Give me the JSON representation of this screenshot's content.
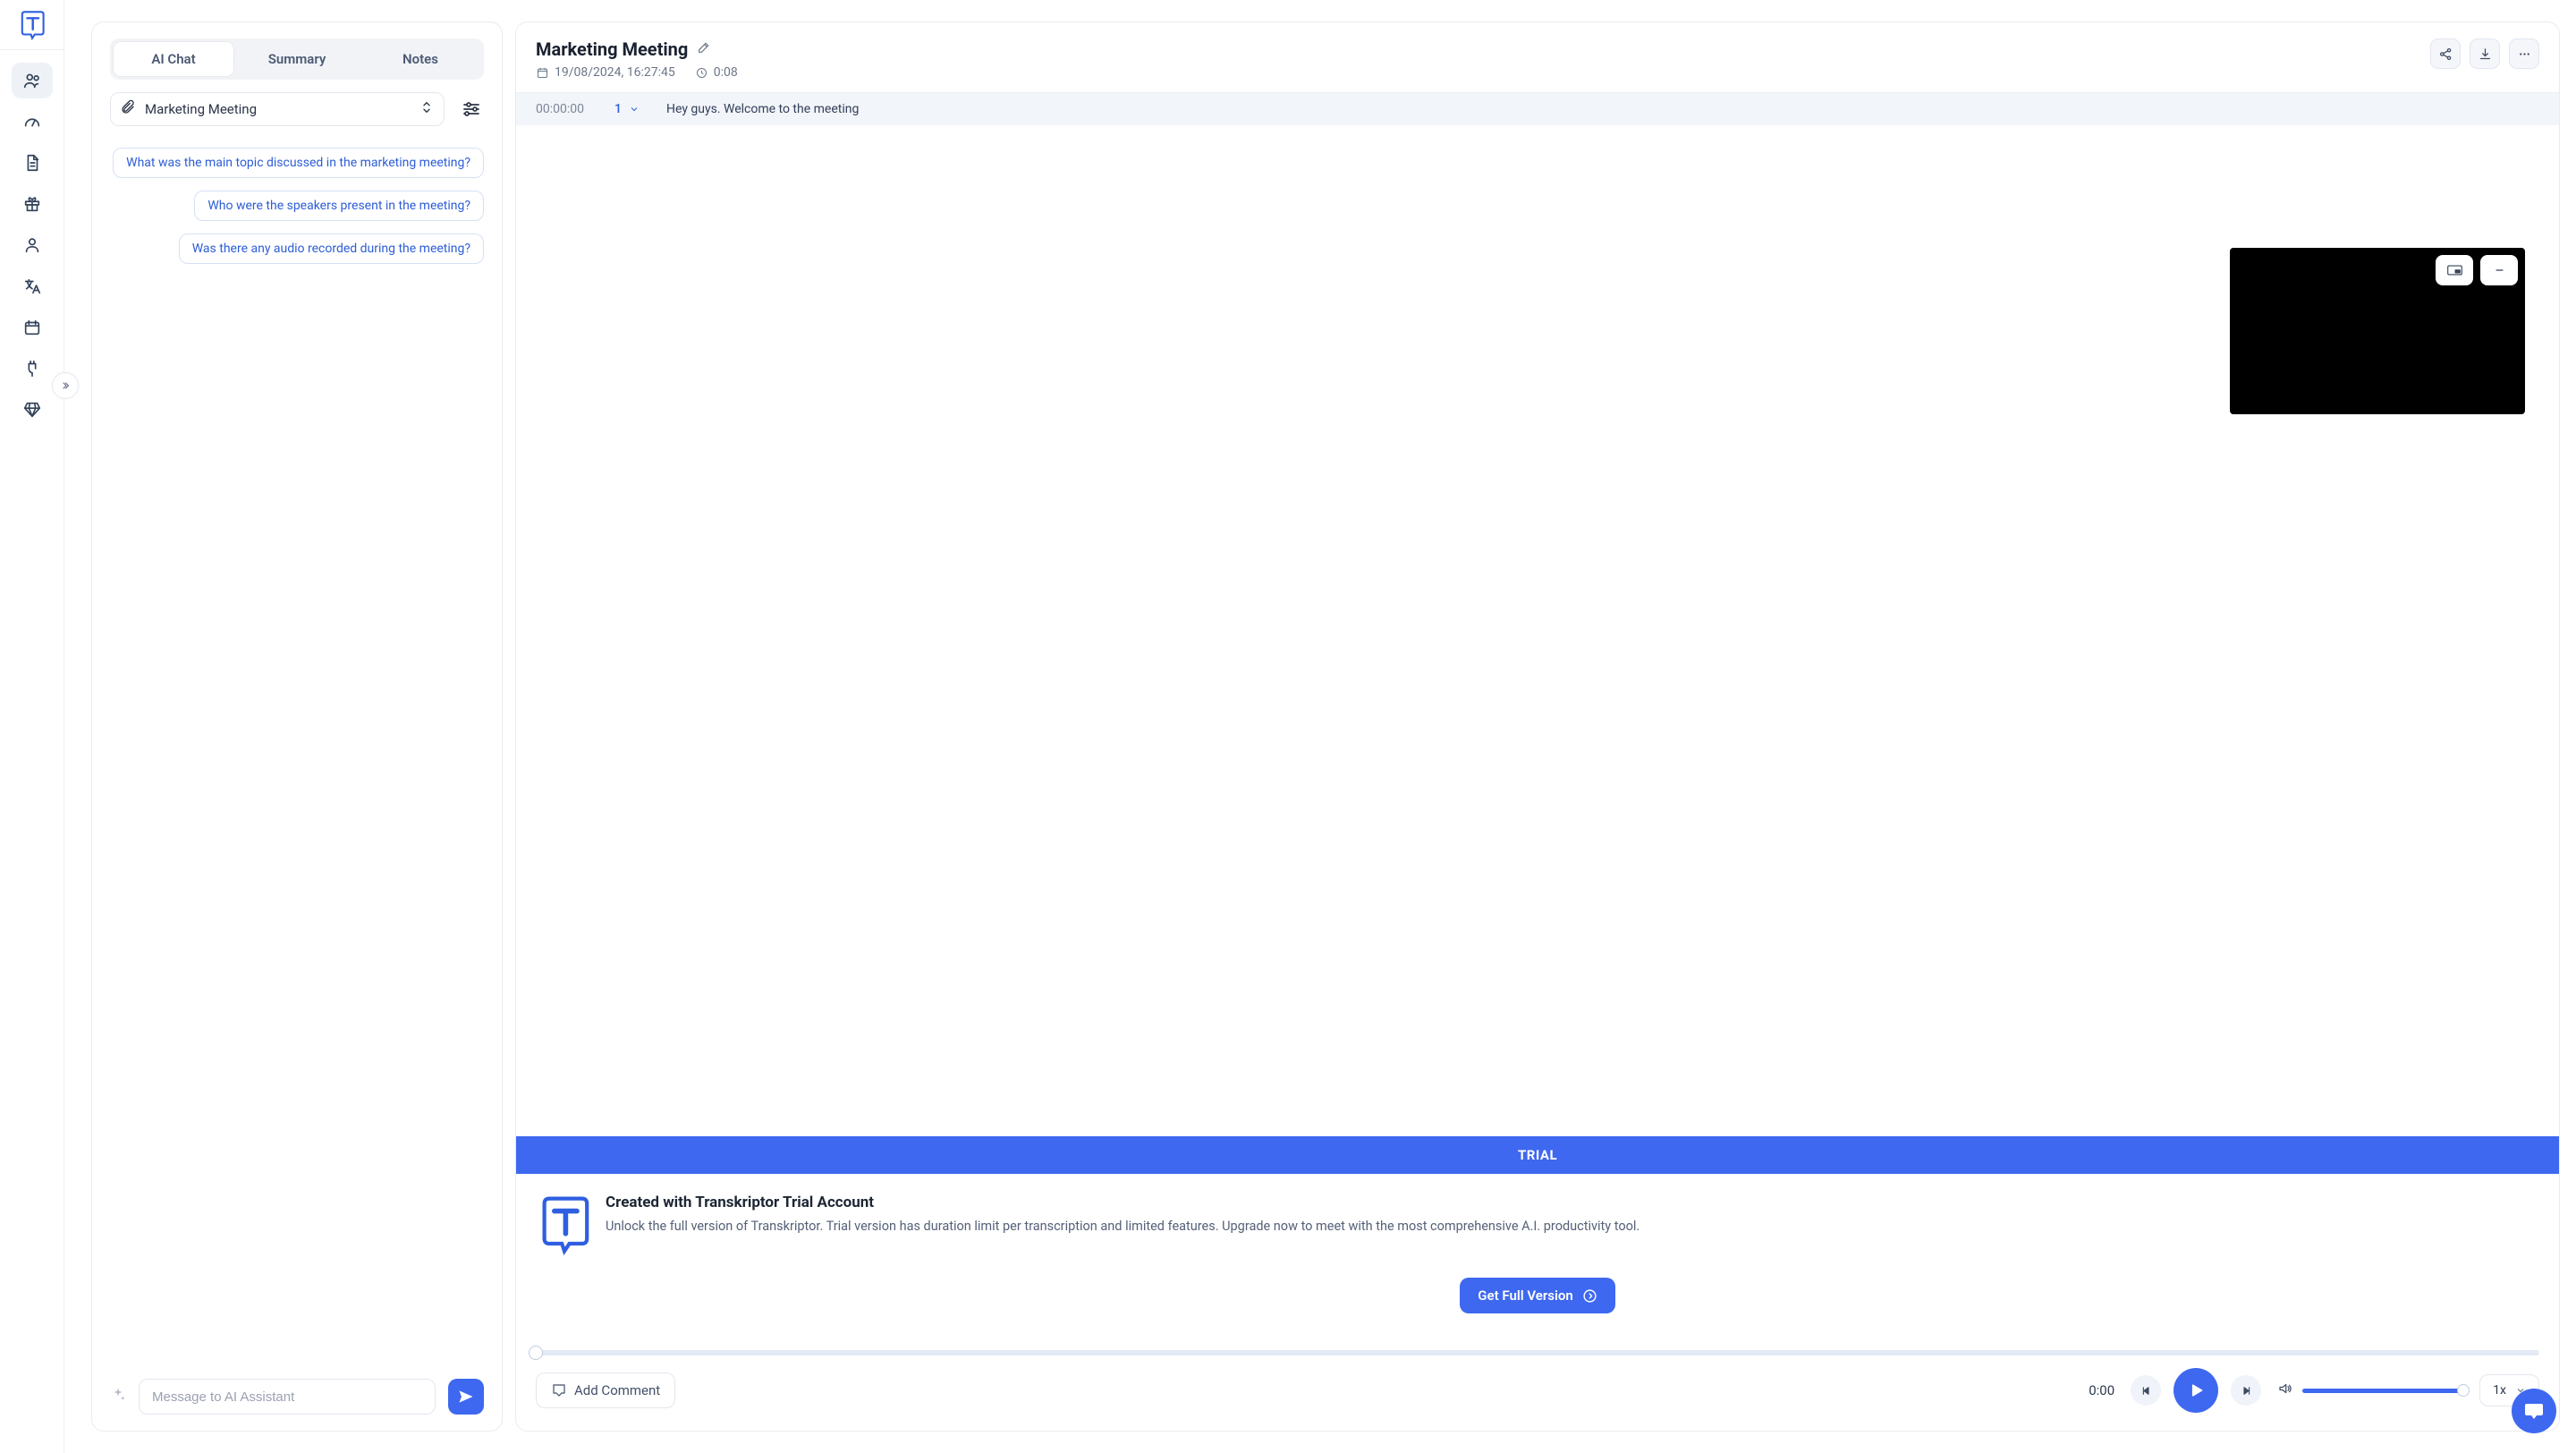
{
  "sidebar": {
    "logo": "T",
    "items": [
      "users",
      "speed",
      "document",
      "rewards",
      "profile",
      "language",
      "calendar",
      "integrations",
      "premium"
    ]
  },
  "tabs": {
    "ai_chat": "AI Chat",
    "summary": "Summary",
    "notes": "Notes",
    "active": "ai_chat"
  },
  "selector": {
    "label": "Marketing Meeting"
  },
  "suggestions": [
    "What was the main topic discussed in the marketing meeting?",
    "Who were the speakers present in the meeting?",
    "Was there any audio recorded during the meeting?"
  ],
  "message_input": {
    "placeholder": "Message to AI Assistant"
  },
  "right": {
    "title": "Marketing Meeting",
    "date": "19/08/2024, 16:27:45",
    "duration": "0:08"
  },
  "transcript": [
    {
      "time": "00:00:00",
      "speaker": "1",
      "text": "Hey guys. Welcome to the meeting"
    }
  ],
  "trial": {
    "bar": "TRIAL",
    "heading": "Created with Transkriptor Trial Account",
    "body": "Unlock the full version of Transkriptor. Trial version has duration limit per transcription and limited features. Upgrade now to meet with the most comprehensive A.I. productivity tool.",
    "cta": "Get Full Version"
  },
  "player": {
    "add_comment": "Add Comment",
    "position": "0:00",
    "speed": "1x"
  }
}
